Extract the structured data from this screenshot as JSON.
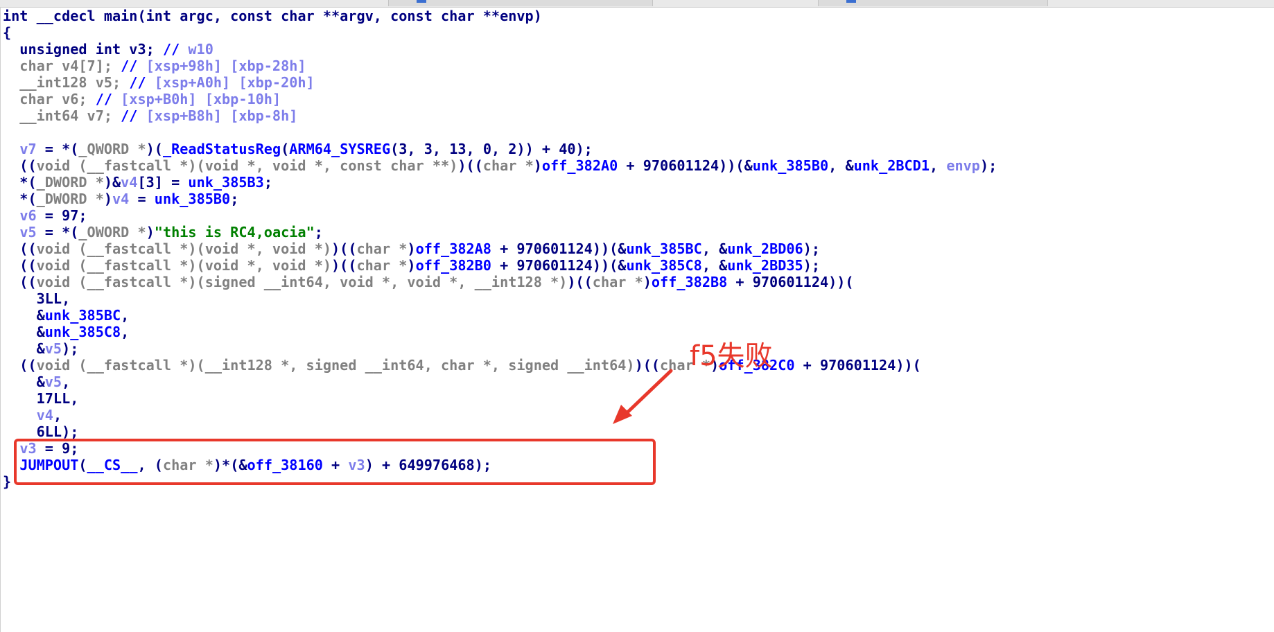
{
  "code_lines": [
    [
      [
        "kw",
        "int __cdecl main(int argc, const char **argv, const char **envp)"
      ]
    ],
    [
      [
        "kw",
        "{"
      ]
    ],
    [
      [
        "kw",
        "  unsigned int v3; "
      ],
      [
        "blue",
        "// "
      ],
      [
        "lv",
        "w10"
      ]
    ],
    [
      [
        "gray",
        "  char v4[7]; "
      ],
      [
        "blue",
        "// "
      ],
      [
        "lv",
        "[xsp+98h] [xbp-28h]"
      ]
    ],
    [
      [
        "gray",
        "  __int128 v5; "
      ],
      [
        "blue",
        "// "
      ],
      [
        "lv",
        "[xsp+A0h] [xbp-20h]"
      ]
    ],
    [
      [
        "gray",
        "  char v6; "
      ],
      [
        "blue",
        "// "
      ],
      [
        "lv",
        "[xsp+B0h] [xbp-10h]"
      ]
    ],
    [
      [
        "gray",
        "  __int64 v7; "
      ],
      [
        "blue",
        "// "
      ],
      [
        "lv",
        "[xsp+B8h] [xbp-8h]"
      ]
    ],
    [
      [
        "kw",
        ""
      ]
    ],
    [
      [
        "kw",
        "  "
      ],
      [
        "lv",
        "v7"
      ],
      [
        "kw",
        " = *("
      ],
      [
        "gray",
        "_QWORD *"
      ],
      [
        "kw",
        ")("
      ],
      [
        "blue",
        "_ReadStatusReg"
      ],
      [
        "kw",
        "("
      ],
      [
        "blue",
        "ARM64_SYSREG"
      ],
      [
        "kw",
        "(3, 3, 13, 0, 2)) + 40);"
      ]
    ],
    [
      [
        "kw",
        "  (("
      ],
      [
        "gray",
        "void (__fastcall *)(void *, void *, const char **)"
      ],
      [
        "kw",
        ")(("
      ],
      [
        "gray",
        "char *"
      ],
      [
        "kw",
        ")"
      ],
      [
        "blue",
        "off_382A0"
      ],
      [
        "kw",
        " + 970601124))(&"
      ],
      [
        "blue",
        "unk_385B0"
      ],
      [
        "kw",
        ", &"
      ],
      [
        "blue",
        "unk_2BCD1"
      ],
      [
        "kw",
        ", "
      ],
      [
        "lv",
        "envp"
      ],
      [
        "kw",
        ");"
      ]
    ],
    [
      [
        "kw",
        "  *("
      ],
      [
        "gray",
        "_DWORD *"
      ],
      [
        "kw",
        ")&"
      ],
      [
        "lv",
        "v4"
      ],
      [
        "kw",
        "[3] = "
      ],
      [
        "blue",
        "unk_385B3"
      ],
      [
        "kw",
        ";"
      ]
    ],
    [
      [
        "kw",
        "  *("
      ],
      [
        "gray",
        "_DWORD *"
      ],
      [
        "kw",
        ")"
      ],
      [
        "lv",
        "v4"
      ],
      [
        "kw",
        " = "
      ],
      [
        "blue",
        "unk_385B0"
      ],
      [
        "kw",
        ";"
      ]
    ],
    [
      [
        "kw",
        "  "
      ],
      [
        "lv",
        "v6"
      ],
      [
        "kw",
        " = 97;"
      ]
    ],
    [
      [
        "kw",
        "  "
      ],
      [
        "lv",
        "v5"
      ],
      [
        "kw",
        " = *("
      ],
      [
        "gray",
        "_OWORD *"
      ],
      [
        "kw",
        ")"
      ],
      [
        "str",
        "\"this is RC4,oacia\""
      ],
      [
        "kw",
        ";"
      ]
    ],
    [
      [
        "kw",
        "  (("
      ],
      [
        "gray",
        "void (__fastcall *)(void *, void *)"
      ],
      [
        "kw",
        ")(("
      ],
      [
        "gray",
        "char *"
      ],
      [
        "kw",
        ")"
      ],
      [
        "blue",
        "off_382A8"
      ],
      [
        "kw",
        " + 970601124))(&"
      ],
      [
        "blue",
        "unk_385BC"
      ],
      [
        "kw",
        ", &"
      ],
      [
        "blue",
        "unk_2BD06"
      ],
      [
        "kw",
        ");"
      ]
    ],
    [
      [
        "kw",
        "  (("
      ],
      [
        "gray",
        "void (__fastcall *)(void *, void *)"
      ],
      [
        "kw",
        ")(("
      ],
      [
        "gray",
        "char *"
      ],
      [
        "kw",
        ")"
      ],
      [
        "blue",
        "off_382B0"
      ],
      [
        "kw",
        " + 970601124))(&"
      ],
      [
        "blue",
        "unk_385C8"
      ],
      [
        "kw",
        ", &"
      ],
      [
        "blue",
        "unk_2BD35"
      ],
      [
        "kw",
        ");"
      ]
    ],
    [
      [
        "kw",
        "  (("
      ],
      [
        "gray",
        "void (__fastcall *)(signed __int64, void *, void *, __int128 *)"
      ],
      [
        "kw",
        ")(("
      ],
      [
        "gray",
        "char *"
      ],
      [
        "kw",
        ")"
      ],
      [
        "blue",
        "off_382B8"
      ],
      [
        "kw",
        " + 970601124))("
      ]
    ],
    [
      [
        "kw",
        "    3LL,"
      ]
    ],
    [
      [
        "kw",
        "    &"
      ],
      [
        "blue",
        "unk_385BC"
      ],
      [
        "kw",
        ","
      ]
    ],
    [
      [
        "kw",
        "    &"
      ],
      [
        "blue",
        "unk_385C8"
      ],
      [
        "kw",
        ","
      ]
    ],
    [
      [
        "kw",
        "    &"
      ],
      [
        "lv",
        "v5"
      ],
      [
        "kw",
        ");"
      ]
    ],
    [
      [
        "kw",
        "  (("
      ],
      [
        "gray",
        "void (__fastcall *)(__int128 *, signed __int64, char *, signed __int64)"
      ],
      [
        "kw",
        ")(("
      ],
      [
        "gray",
        "char *"
      ],
      [
        "kw",
        ")"
      ],
      [
        "blue",
        "off_382C0"
      ],
      [
        "kw",
        " + 970601124))("
      ]
    ],
    [
      [
        "kw",
        "    &"
      ],
      [
        "lv",
        "v5"
      ],
      [
        "kw",
        ","
      ]
    ],
    [
      [
        "kw",
        "    17LL,"
      ]
    ],
    [
      [
        "kw",
        "    "
      ],
      [
        "lv",
        "v4"
      ],
      [
        "kw",
        ","
      ]
    ],
    [
      [
        "kw",
        "    6LL);"
      ]
    ],
    [
      [
        "kw",
        "  "
      ],
      [
        "lv",
        "v3"
      ],
      [
        "kw",
        " = 9;"
      ]
    ],
    [
      [
        "kw",
        "  "
      ],
      [
        "blue",
        "JUMPOUT"
      ],
      [
        "kw",
        "("
      ],
      [
        "blue",
        "__CS__"
      ],
      [
        "kw",
        ", ("
      ],
      [
        "gray",
        "char *"
      ],
      [
        "kw",
        ")*(&"
      ],
      [
        "blue",
        "off_38160"
      ],
      [
        "kw",
        " + "
      ],
      [
        "lv",
        "v3"
      ],
      [
        "kw",
        ") + 649976468);"
      ]
    ],
    [
      [
        "kw",
        "}"
      ]
    ]
  ],
  "annotation": {
    "label": "f5失败",
    "color": "#e8382b"
  },
  "colors": {
    "keyword": "#000080",
    "type": "#808080",
    "local_var": "#7d7dea",
    "symbol": "#0000ff",
    "string": "#008000",
    "annotation": "#e8382b"
  }
}
